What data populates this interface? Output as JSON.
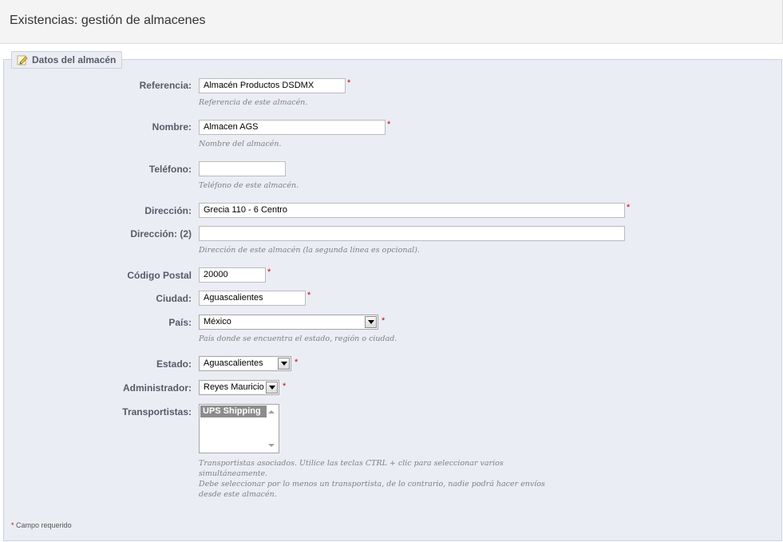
{
  "header": {
    "title": "Existencias: gestión de almacenes"
  },
  "fieldset": {
    "legend": "Datos del almacén"
  },
  "form": {
    "reference": {
      "label": "Referencia:",
      "value": "Almacén Productos DSDMX",
      "hint": "Referencia de este almacén."
    },
    "name": {
      "label": "Nombre:",
      "value": "Almacen AGS",
      "hint": "Nombre del almacén."
    },
    "phone": {
      "label": "Teléfono:",
      "value": "",
      "hint": "Teléfono de este almacén."
    },
    "address": {
      "label": "Dirección:",
      "value": "Grecia 110 - 6 Centro"
    },
    "address2": {
      "label": "Dirección: (2)",
      "value": "",
      "hint": "Dirección de este almacén (la segunda línea es opcional)."
    },
    "postcode": {
      "label": "Código Postal",
      "value": "20000"
    },
    "city": {
      "label": "Ciudad:",
      "value": "Aguascalientes"
    },
    "country": {
      "label": "País:",
      "selected": "México",
      "hint": "País donde se encuentra el estado, región o ciudad."
    },
    "state": {
      "label": "Estado:",
      "selected": "Aguascalientes"
    },
    "manager": {
      "label": "Administrador:",
      "selected": "Reyes Mauricio"
    },
    "carriers": {
      "label": "Transportistas:",
      "options": [
        "UPS Shipping"
      ],
      "hint_lines": [
        "Transportistas asociados. Utilice las teclas CTRL + clic para seleccionar varios",
        "simultáneamente.",
        "Debe seleccionar por lo menos un transportista, de lo contrario, nadie podrá hacer envíos",
        "desde este almacén."
      ]
    },
    "required_mark": "*"
  },
  "footer": {
    "required_note": "Campo requerido",
    "required_mark": "*"
  }
}
